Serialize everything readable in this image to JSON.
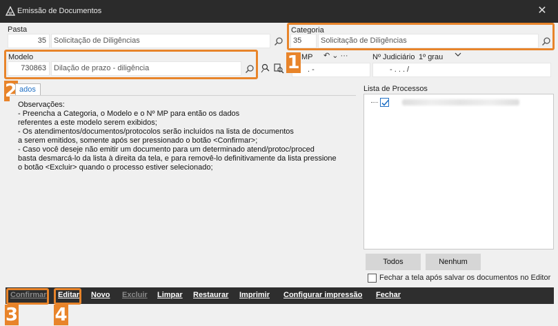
{
  "window": {
    "title": "Emissão de Documentos",
    "close_glyph": "✕",
    "app_icon": "app-logo-icon",
    "close_icon": "close-icon"
  },
  "pasta": {
    "label": "Pasta",
    "code": "35",
    "value": "Solicitação de Diligências"
  },
  "categoria": {
    "label": "Categoria",
    "code": "35",
    "value": "Solicitação de Diligências"
  },
  "modelo": {
    "label": "Modelo",
    "code": "730863",
    "value": "Dilação de prazo - diligência"
  },
  "mp": {
    "label": "MP",
    "prefix_digit": "1",
    "value": ".        -",
    "arrows": "↶ ⌄ ···"
  },
  "judiciario": {
    "label": "Nº Judiciário",
    "grau": "1º grau",
    "value": "-      .   .   .      /"
  },
  "tab": {
    "label": "ados"
  },
  "observacoes": {
    "lines": [
      "Observações:",
      "  - Preencha a Categoria, o Modelo e o Nº MP para então os dados",
      "referentes a este modelo serem exibidos;",
      "  - Os atendimentos/documentos/protocolos serão incluídos na lista de documentos",
      "a serem emitidos, somente após ser pressionado o botão <Confirmar>;",
      "  - Caso você deseje não emitir um documento para um determinado atend/protoc/proced",
      "basta desmarcá-lo da lista à direita da tela, e para removê-lo definitivamente da lista pressione",
      "o botão <Excluir> quando o processo estiver selecionado;"
    ]
  },
  "processos": {
    "label": "Lista de Processos",
    "todos": "Todos",
    "nenhum": "Nenhum"
  },
  "fechar_tela": {
    "label": "Fechar a tela após salvar os documentos no Editor"
  },
  "toolbar": {
    "confirmar": "Confirmar",
    "editar": "Editar",
    "novo": "Novo",
    "excluir": "Excluir",
    "limpar": "Limpar",
    "restaurar": "Restaurar",
    "imprimir": "Imprimir",
    "config": "Configurar impressão",
    "fechar": "Fechar"
  },
  "badges": {
    "b1": "1",
    "b2": "2",
    "b3": "3",
    "b4": "4"
  },
  "colors": {
    "highlight": "#e8842a",
    "titlebar": "#2b2b2b",
    "toolbar": "#2e2e2e",
    "link": "#1f6fc4"
  }
}
